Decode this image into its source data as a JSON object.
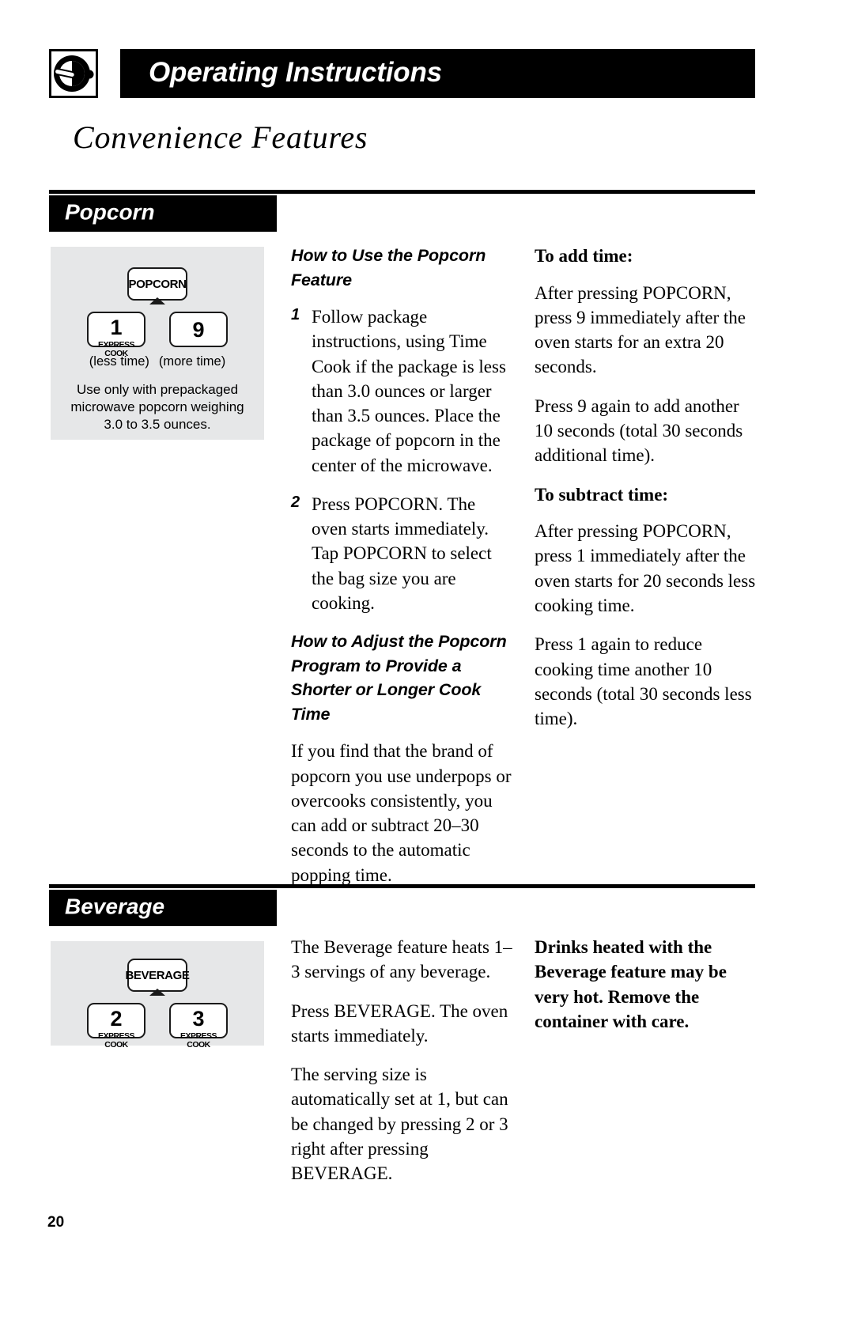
{
  "header": {
    "icon_name": "dial-knob-icon",
    "title": "Operating Instructions"
  },
  "page_title": "Convenience Features",
  "page_number": "20",
  "sections": [
    {
      "id": "popcorn",
      "label": "Popcorn",
      "keypad": {
        "main_key": "POPCORN",
        "keys": [
          {
            "number": "1",
            "sub": "EXPRESS COOK"
          },
          {
            "number": "9",
            "sub": ""
          }
        ],
        "captions": [
          "(less time)",
          "(more time)"
        ],
        "note": "Use only with prepackaged microwave popcorn weighing 3.0 to 3.5 ounces."
      },
      "middle_column": {
        "heading": "How to Use the Popcorn Feature",
        "steps": [
          {
            "num": "1",
            "text": "Follow package instructions, using Time Cook if the package is less than 3.0 ounces or larger than 3.5 ounces. Place the package of popcorn in the center of the microwave."
          },
          {
            "num": "2",
            "text": "Press POPCORN. The oven starts immediately. Tap POPCORN to select the bag size you are cooking."
          }
        ],
        "heading2": "How to Adjust the Popcorn Program to Provide a Shorter or Longer Cook Time",
        "paragraph": "If you find that the brand of popcorn you use underpops or overcooks consistently, you can add or subtract 20–30 seconds to the automatic popping time."
      },
      "right_column": {
        "add_heading": "To add time:",
        "add_paragraphs": [
          "After pressing POPCORN, press 9 immediately after the oven starts for an extra 20 seconds.",
          "Press 9 again to add another 10 seconds (total 30 seconds additional time)."
        ],
        "subtract_heading": "To subtract time:",
        "subtract_paragraphs": [
          "After pressing POPCORN, press 1 immediately after the oven starts for 20 seconds less cooking time.",
          "Press 1 again to reduce cooking time another 10 seconds (total 30 seconds less time)."
        ]
      }
    },
    {
      "id": "beverage",
      "label": "Beverage",
      "keypad": {
        "main_key": "BEVERAGE",
        "keys": [
          {
            "number": "2",
            "sub": "EXPRESS COOK"
          },
          {
            "number": "3",
            "sub": "EXPRESS COOK"
          }
        ]
      },
      "middle_column": {
        "paragraphs": [
          "The Beverage feature heats 1–3 servings of any beverage.",
          "Press BEVERAGE. The oven starts immediately.",
          "The serving size is automatically set at 1, but can be changed by pressing 2 or 3 right after pressing BEVERAGE."
        ]
      },
      "right_column": {
        "warning": "Drinks heated with the Beverage feature may be very hot. Remove the container with care."
      }
    }
  ],
  "colors": {
    "ink": "#000000",
    "panel": "#e6e7e8",
    "paper": "#ffffff"
  }
}
